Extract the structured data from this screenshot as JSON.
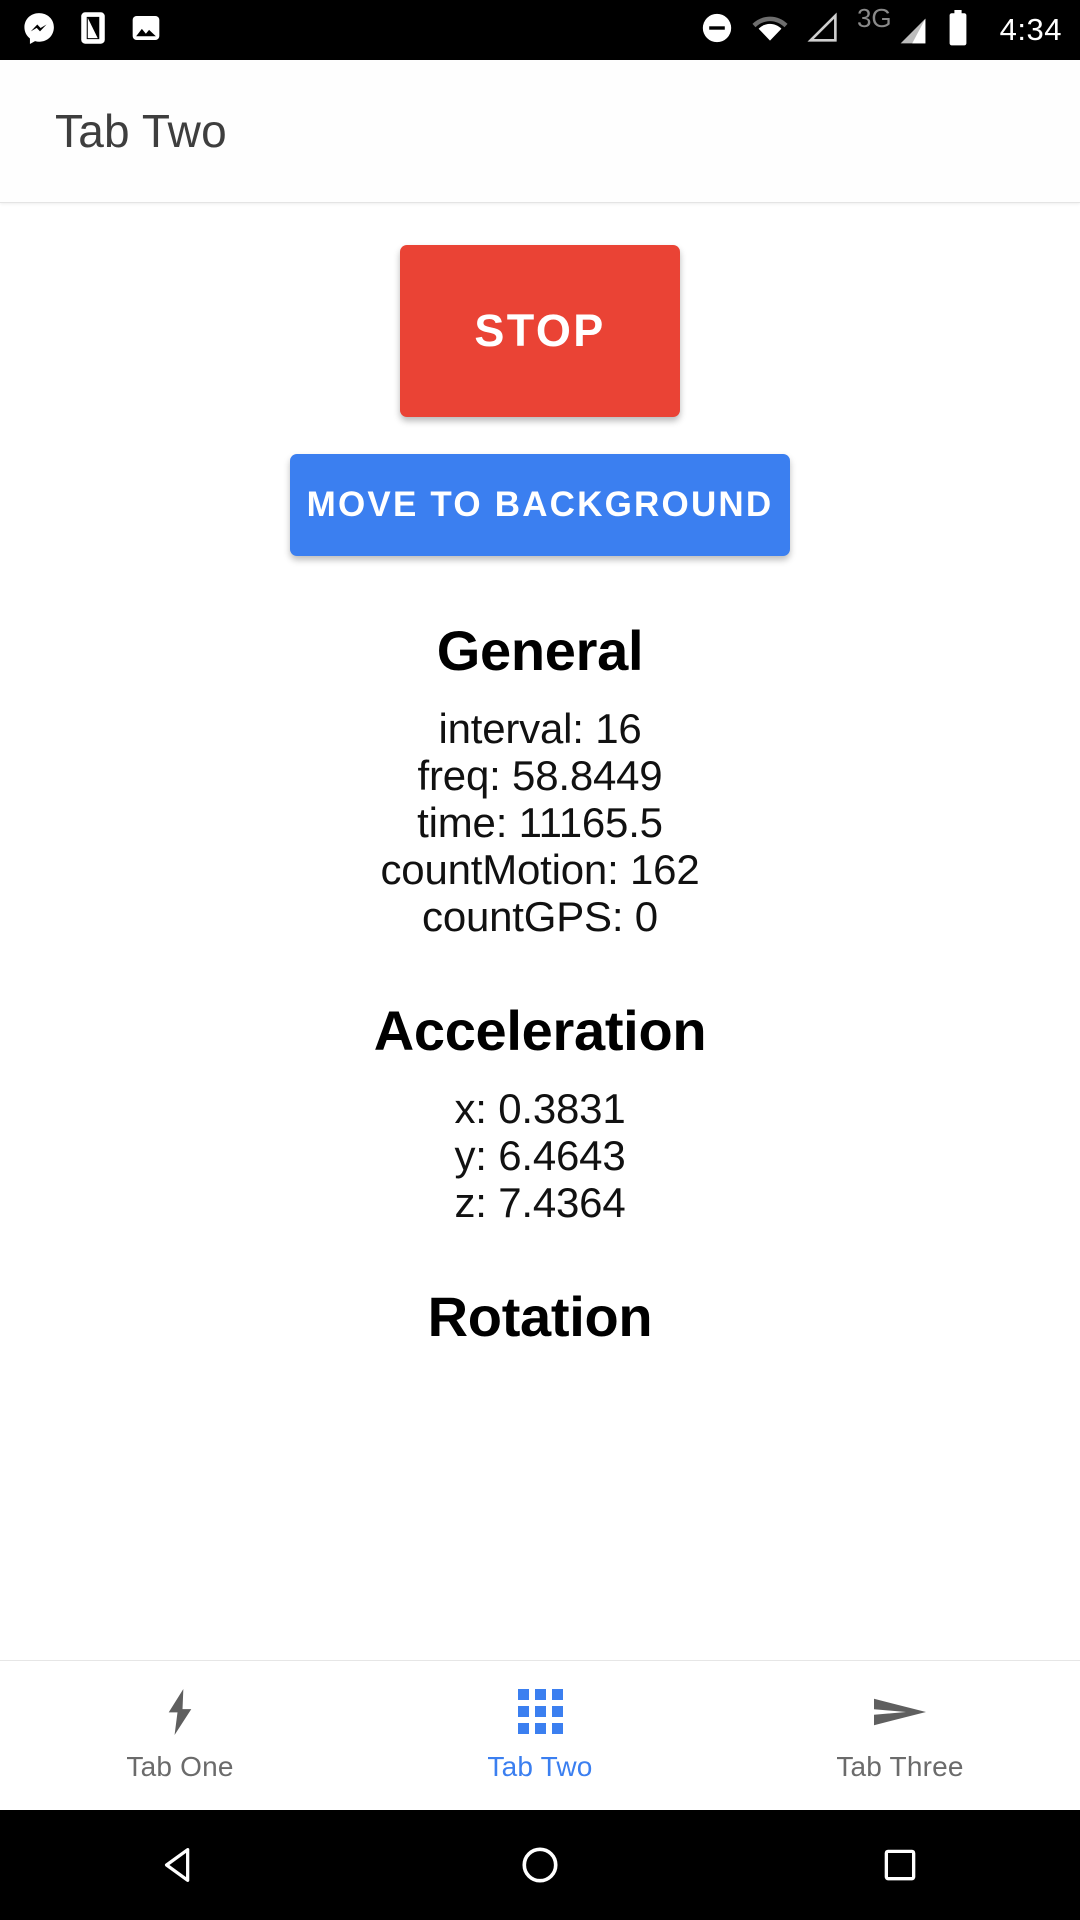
{
  "status_bar": {
    "time": "4:34",
    "left_icons": [
      "messenger-icon",
      "phone-icon",
      "image-icon"
    ],
    "right_icons": [
      "do-not-disturb-icon",
      "wifi-icon",
      "signal-empty-icon",
      "signal-3g-icon",
      "battery-icon"
    ],
    "network_label": "3G"
  },
  "app_bar": {
    "title": "Tab Two"
  },
  "actions": {
    "stop_label": "STOP",
    "move_to_background_label": "MOVE TO BACKGROUND",
    "stop_color": "#ea4335",
    "move_color": "#3b7ff0"
  },
  "sections": [
    {
      "heading": "General",
      "rows": [
        "interval: 16",
        "freq: 58.8449",
        "time: 11165.5",
        "countMotion: 162",
        "countGPS: 0"
      ]
    },
    {
      "heading": "Acceleration",
      "rows": [
        "x: 0.3831",
        "y: 6.4643",
        "z: 7.4364"
      ]
    },
    {
      "heading": "Rotation",
      "rows": []
    }
  ],
  "tab_bar": {
    "active_color": "#3b7ff0",
    "inactive_color": "#6b6b6b",
    "tabs": [
      {
        "label": "Tab One",
        "icon": "bolt-icon",
        "active": false
      },
      {
        "label": "Tab Two",
        "icon": "grid-icon",
        "active": true
      },
      {
        "label": "Tab Three",
        "icon": "send-icon",
        "active": false
      }
    ]
  },
  "nav_bar": {
    "buttons": [
      {
        "name": "back-button",
        "icon": "triangle-back-icon"
      },
      {
        "name": "home-button",
        "icon": "circle-home-icon"
      },
      {
        "name": "recents-button",
        "icon": "square-recents-icon"
      }
    ]
  }
}
